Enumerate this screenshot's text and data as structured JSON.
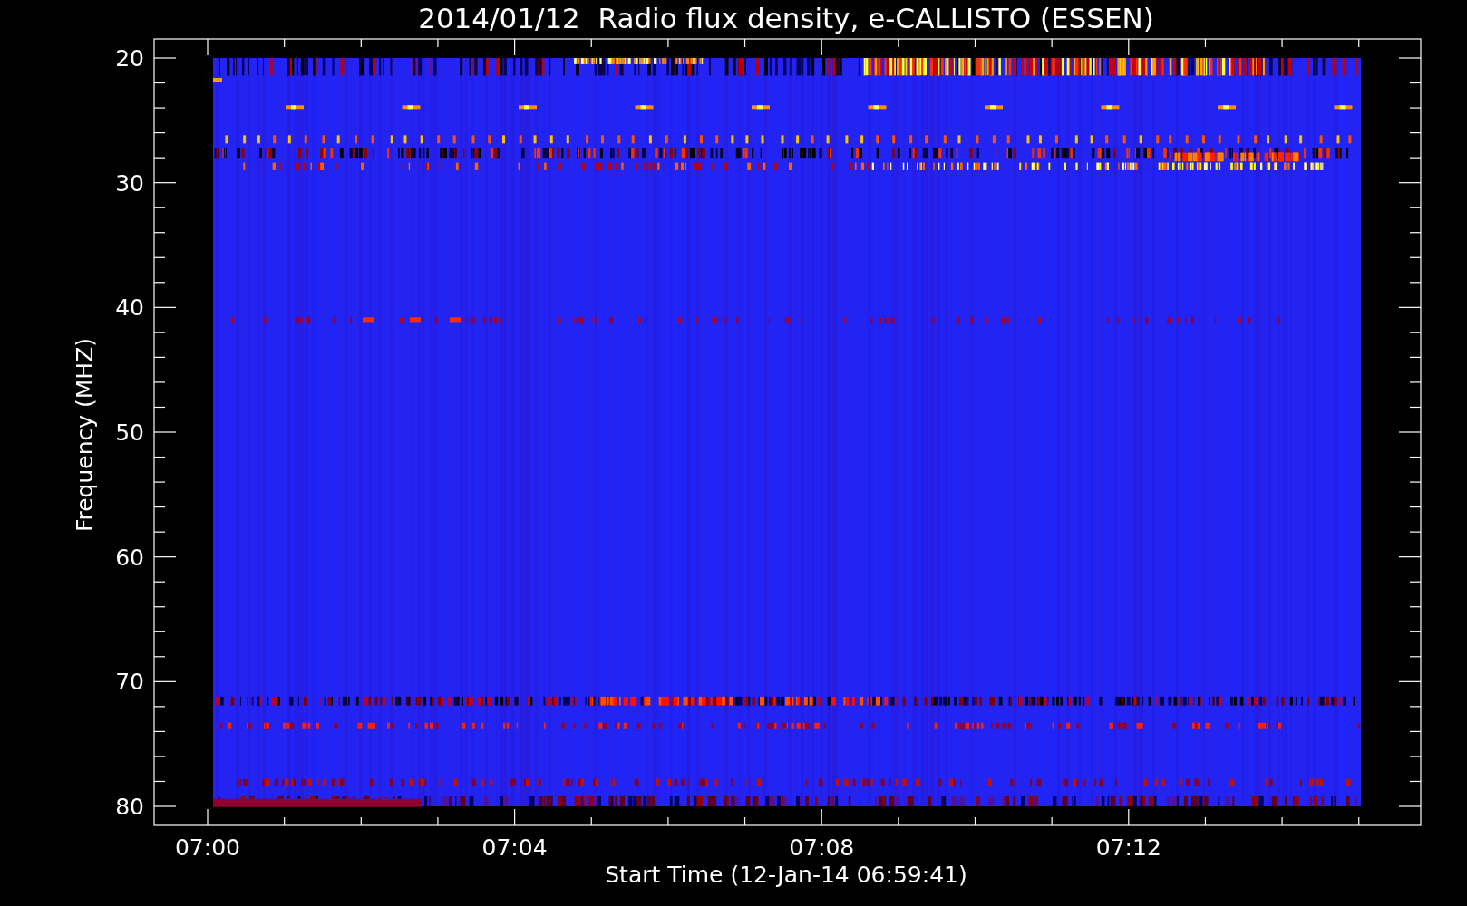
{
  "chart": {
    "title": "2014/01/12  Radio flux density, e-CALLISTO (ESSEN)",
    "xlabel": "Start Time (12-Jan-14 06:59:41)",
    "ylabel": "Frequency (MHZ)",
    "xtick_labels": [
      "07:00",
      "07:04",
      "07:08",
      "07:12"
    ],
    "ytick_labels": [
      "20",
      "30",
      "40",
      "50",
      "60",
      "70",
      "80"
    ]
  }
}
